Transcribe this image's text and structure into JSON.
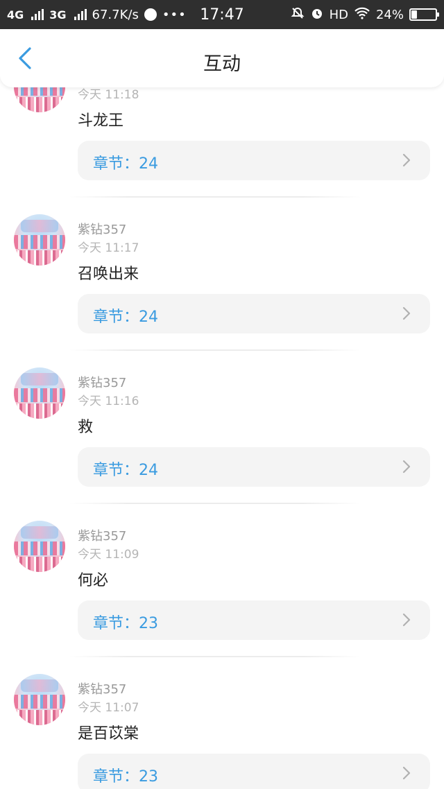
{
  "status_bar": {
    "network1": "4G",
    "network2": "3G",
    "speed": "67.7K/s",
    "more": "•••",
    "time": "17:47",
    "hd": "HD",
    "battery": "24%",
    "battery_level": 0.24,
    "icons": [
      "signal-icon",
      "browser-icon",
      "mute-icon",
      "alarm-icon",
      "wifi-icon",
      "battery-icon"
    ]
  },
  "header": {
    "title": "互动",
    "back_icon": "chevron-left-icon",
    "accent": "#3a9be0"
  },
  "items": [
    {
      "username": "",
      "time": "今天 11:18",
      "comment": "斗龙王",
      "chapter": "章节：24"
    },
    {
      "username": "紫钻357",
      "time": "今天 11:17",
      "comment": "召唤出来",
      "chapter": "章节：24"
    },
    {
      "username": "紫钻357",
      "time": "今天 11:16",
      "comment": "救",
      "chapter": "章节：24"
    },
    {
      "username": "紫钻357",
      "time": "今天 11:09",
      "comment": "何必",
      "chapter": "章节：23"
    },
    {
      "username": "紫钻357",
      "time": "今天 11:07",
      "comment": "是百苡棠",
      "chapter": "章节：23"
    }
  ]
}
